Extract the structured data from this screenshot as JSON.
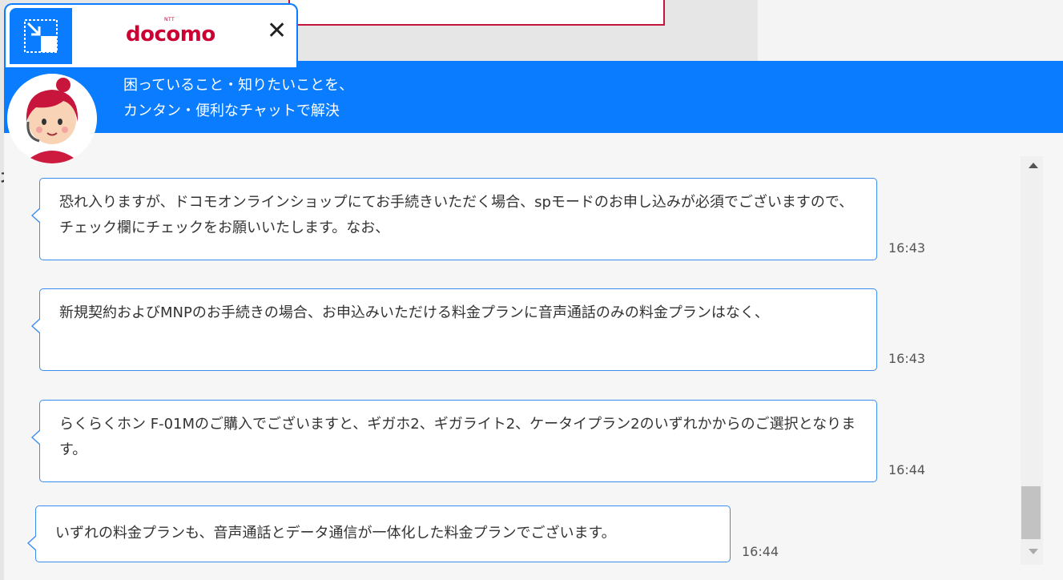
{
  "tab": {
    "logo_text": "docomo",
    "logo_ntt": "NTT",
    "close_glyph": "✕",
    "minimize_icon": "minimize-arrow-icon"
  },
  "header": {
    "line1": "困っていること・知りたいことを、",
    "line2": "カンタン・便利なチャットで解決"
  },
  "background": {
    "edge_glyph": "否"
  },
  "messages": [
    {
      "text": "恐れ入りますが、ドコモオンラインショップにてお手続きいただく場合、spモードのお申し込みが必須でございますので、チェック欄にチェックをお願いいたします。なお、",
      "time": "16:43"
    },
    {
      "text": "新規契約およびMNPのお手続きの場合、お申込みいただける料金プランに音声通話のみの料金プランはなく、",
      "time": "16:43"
    },
    {
      "text": "らくらくホン F-01Mのご購入でございますと、ギガホ2、ギガライト2、ケータイプラン2のいずれかからのご選択となります。",
      "time": "16:44"
    },
    {
      "text": "いずれの料金プランも、音声通話とデータ通信が一体化した料金プランでございます。",
      "time": "16:44"
    }
  ],
  "colors": {
    "brand_blue": "#0a7cff",
    "docomo_red": "#cc0033",
    "bubble_border": "#3a8cf0"
  }
}
